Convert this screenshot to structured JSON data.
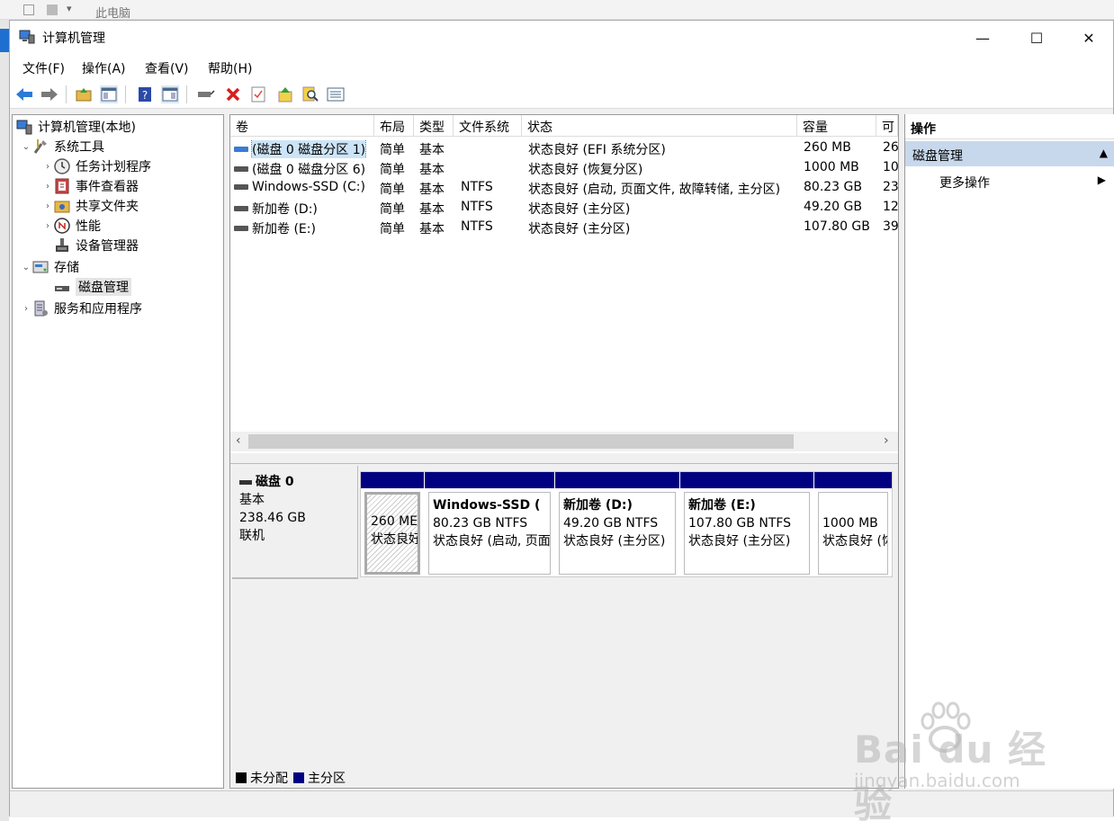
{
  "background_window": {
    "title": "此电脑"
  },
  "window": {
    "title": "计算机管理",
    "controls": {
      "minimize": "—",
      "maximize": "☐",
      "close": "✕"
    }
  },
  "menu": [
    "文件(F)",
    "操作(A)",
    "查看(V)",
    "帮助(H)"
  ],
  "toolbar": {
    "icons": [
      "back-icon",
      "forward-icon",
      "up-folder-icon",
      "show-hide-console-tree-icon",
      "help-icon",
      "properties-icon",
      "connect-icon",
      "delete-icon",
      "check-icon",
      "export-icon",
      "search-icon",
      "list-icon"
    ]
  },
  "tree": {
    "root": "计算机管理(本地)",
    "system_tools": "系统工具",
    "task_scheduler": "任务计划程序",
    "event_viewer": "事件查看器",
    "shared_folders": "共享文件夹",
    "performance": "性能",
    "device_manager": "设备管理器",
    "storage": "存储",
    "disk_management": "磁盘管理",
    "services_apps": "服务和应用程序"
  },
  "volumes": {
    "columns": [
      "卷",
      "布局",
      "类型",
      "文件系统",
      "状态",
      "容量",
      "可"
    ],
    "rows": [
      {
        "name": "(磁盘 0 磁盘分区 1)",
        "layout": "简单",
        "type": "基本",
        "fs": "",
        "status": "状态良好 (EFI 系统分区)",
        "capacity": "260 MB",
        "free": "26"
      },
      {
        "name": "(磁盘 0 磁盘分区 6)",
        "layout": "简单",
        "type": "基本",
        "fs": "",
        "status": "状态良好 (恢复分区)",
        "capacity": "1000 MB",
        "free": "10"
      },
      {
        "name": "Windows-SSD (C:)",
        "layout": "简单",
        "type": "基本",
        "fs": "NTFS",
        "status": "状态良好 (启动, 页面文件, 故障转储, 主分区)",
        "capacity": "80.23 GB",
        "free": "23"
      },
      {
        "name": "新加卷 (D:)",
        "layout": "简单",
        "type": "基本",
        "fs": "NTFS",
        "status": "状态良好 (主分区)",
        "capacity": "49.20 GB",
        "free": "12"
      },
      {
        "name": "新加卷 (E:)",
        "layout": "简单",
        "type": "基本",
        "fs": "NTFS",
        "status": "状态良好 (主分区)",
        "capacity": "107.80 GB",
        "free": "39"
      }
    ]
  },
  "disk": {
    "name": "磁盘 0",
    "type": "基本",
    "size": "238.46 GB",
    "state": "联机",
    "partitions": [
      {
        "name": "",
        "line1": "260 ME",
        "line2": "状态良好"
      },
      {
        "name": "Windows-SSD (",
        "line1": "80.23 GB NTFS",
        "line2": "状态良好 (启动, 页面"
      },
      {
        "name": "新加卷 (D:)",
        "line1": "49.20 GB NTFS",
        "line2": "状态良好 (主分区)"
      },
      {
        "name": "新加卷 (E:)",
        "line1": "107.80 GB NTFS",
        "line2": "状态良好 (主分区)"
      },
      {
        "name": "",
        "line1": "1000 MB",
        "line2": "状态良好 (恢"
      }
    ]
  },
  "legend": {
    "unallocated": "未分配",
    "primary": "主分区",
    "unallocated_color": "#000000",
    "primary_color": "#000080"
  },
  "actions": {
    "header": "操作",
    "section": "磁盘管理",
    "more": "更多操作"
  },
  "watermark": {
    "brand": "Bai du 经验",
    "url": "jingyan.baidu.com"
  }
}
